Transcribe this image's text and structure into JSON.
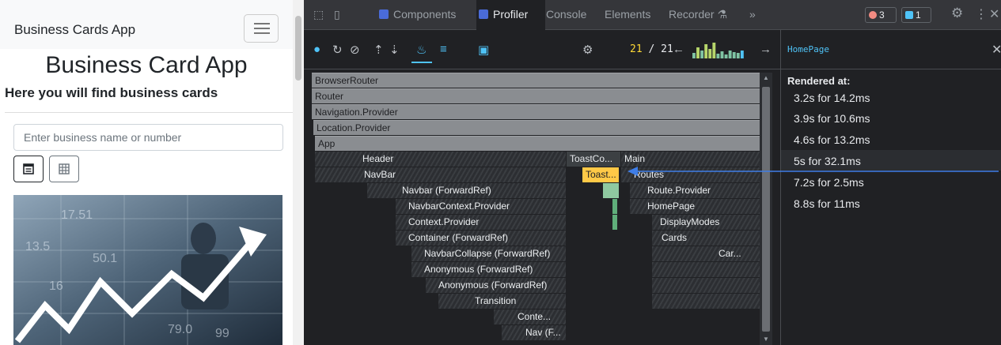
{
  "app": {
    "brand": "Business Cards App",
    "heading": "Business Card App",
    "subheading": "Here you will find business cards",
    "search_placeholder": "Enter business name or number",
    "image_numbers": [
      "17.51",
      "50.1",
      "13.5",
      "79.0",
      "99",
      "16"
    ]
  },
  "devtools": {
    "tabs": [
      "Components",
      "Profiler",
      "Console",
      "Elements",
      "Recorder"
    ],
    "more_tabs": "»",
    "errors_count": "3",
    "messages_count": "1",
    "commit_current": "21",
    "commit_separator": "/",
    "commit_total": "21",
    "commit_bar_heights": [
      0.35,
      0.7,
      0.5,
      0.9,
      0.6,
      1.0,
      0.3,
      0.45,
      0.25,
      0.5,
      0.4,
      0.35,
      0.5
    ],
    "selected_component": "HomePage",
    "rendered_at_label": "Rendered at:",
    "renders": [
      "3.2s for 14.2ms",
      "3.9s for 10.6ms",
      "4.6s for 13.2ms",
      "5s for 32.1ms",
      "7.2s for 2.5ms",
      "8.8s for 11ms"
    ],
    "flame": [
      "BrowserRouter",
      "Router",
      "Navigation.Provider",
      "Location.Provider",
      "App",
      "Header",
      "ToastCo...",
      "Main",
      "NavBar",
      "Toast...",
      "Routes",
      "Navbar (ForwardRef)",
      "Route.Provider",
      "NavbarContext.Provider",
      "HomePage",
      "Context.Provider",
      "DisplayModes",
      "Container (ForwardRef)",
      "Cards",
      "NavbarCollapse (ForwardRef)",
      "Car...",
      "Anonymous (ForwardRef)",
      "Anonymous (ForwardRef)",
      "Transition",
      "Conte...",
      "Nav (F..."
    ]
  },
  "colors": {
    "devtools_bg": "#202124",
    "rendered_bar": "#8a8d91",
    "highlight_yellow": "#ffc947",
    "link_blue": "#4fc3f7",
    "arrow_blue": "#3f7ee8"
  }
}
